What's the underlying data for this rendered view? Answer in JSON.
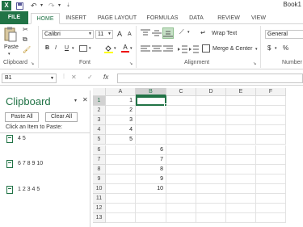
{
  "titlebar": {
    "app_icon": "X",
    "doc_title": "Book1"
  },
  "tabs": [
    "FILE",
    "HOME",
    "INSERT",
    "PAGE LAYOUT",
    "FORMULAS",
    "DATA",
    "REVIEW",
    "VIEW"
  ],
  "ribbon": {
    "paste_label": "Paste",
    "font_name": "Calibri",
    "font_size": "11",
    "grow_font": "A",
    "shrink_font": "A",
    "bold": "B",
    "italic": "I",
    "underline": "U",
    "wrap_text": "Wrap Text",
    "merge_center": "Merge & Center",
    "number_format": "General",
    "currency": "$",
    "percent": "%",
    "groups": {
      "clipboard": "Clipboard",
      "font": "Font",
      "alignment": "Alignment",
      "number": "Number"
    }
  },
  "formula_bar": {
    "name_box": "B1",
    "fx": "fx",
    "cancel": "✕",
    "enter": "✓",
    "value": ""
  },
  "clipboard_pane": {
    "title": "Clipboard",
    "paste_all": "Paste All",
    "clear_all": "Clear All",
    "instruction": "Click an Item to Paste:",
    "items": [
      "4 5",
      "6 7 8 9 10",
      "1 2 3 4 5"
    ]
  },
  "grid": {
    "columns": [
      "A",
      "B",
      "C",
      "D",
      "E",
      "F"
    ],
    "rows": [
      "1",
      "2",
      "3",
      "4",
      "5",
      "6",
      "7",
      "8",
      "9",
      "10",
      "11",
      "12",
      "13"
    ],
    "cells": {
      "A1": "1",
      "A2": "2",
      "A3": "3",
      "A4": "4",
      "A5": "5",
      "B6": "6",
      "B7": "7",
      "B8": "8",
      "B9": "9",
      "B10": "10"
    },
    "selected": "B1"
  },
  "colors": {
    "accent": "#217346"
  }
}
